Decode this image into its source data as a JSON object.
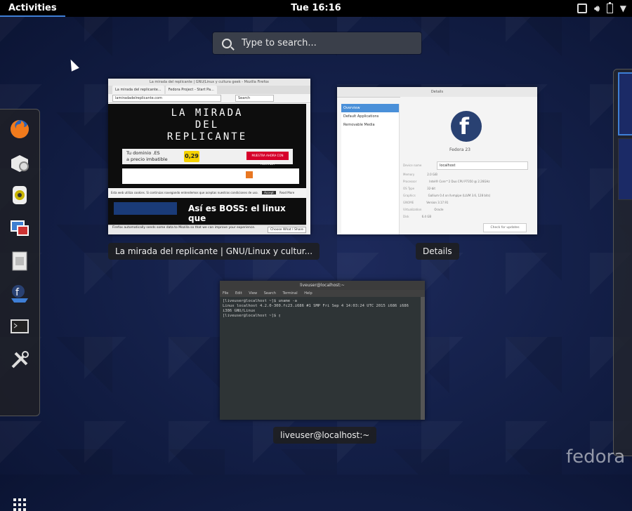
{
  "topbar": {
    "activities": "Activities",
    "clock": "Tue 16:16",
    "tray_icons": [
      "window-icon",
      "volume-icon",
      "battery-icon",
      "menu-arrow-icon"
    ]
  },
  "search": {
    "placeholder": "Type to search..."
  },
  "dash": {
    "apps": [
      "firefox-icon",
      "software-icon",
      "rhythmbox-icon",
      "photos-icon",
      "files-icon",
      "install-icon",
      "terminal-icon",
      "settings-icon"
    ],
    "show_apps": "app-grid-icon"
  },
  "windows": {
    "firefox": {
      "caption": "La mirada del replicante | GNU/Linux y cultur...",
      "title": "La mirada del replicante | GNU/Linux y cultura geek - Mozilla Firefox",
      "tab1": "La mirada del replicante...",
      "tab2": "Fedora Project - Start Pa...",
      "url": "lamiradadelreplicante.com",
      "search": "Search",
      "hero": [
        "LA MIRADA",
        "DEL",
        "REPLICANTE"
      ],
      "ad_line1": "Tu dominio .ES",
      "ad_line2": "a precio imbatible",
      "ad_price": "0,29",
      "ad_cta": "MUESTRA AHORA CON HOSTALIA",
      "headline": "Así es BOSS: el linux que",
      "cookie": "Esta web utiliza cookies. Si continúas navegando entendemos que aceptas nuestras condiciones de uso.",
      "cookie_accept": "Accept",
      "cookie_more": "Read More",
      "notify": "Firefox automatically sends some data to Mozilla so that we can improve your experience.",
      "notify_btn": "Choose What I Share"
    },
    "details": {
      "caption": "Details",
      "title": "Details",
      "sidebar": [
        "Overview",
        "Default Applications",
        "Removable Media"
      ],
      "os": "Fedora 23",
      "device_name_label": "Device name",
      "device_name": "localhost",
      "rows": [
        {
          "label": "Memory",
          "value": "2.0 GiB"
        },
        {
          "label": "Processor",
          "value": "Intel® Core™2 Duo CPU P7350 @ 2.26GHz"
        },
        {
          "label": "OS Type",
          "value": "32-bit"
        },
        {
          "label": "Graphics",
          "value": "Gallium 0.4 on llvmpipe (LLVM 3.6, 128 bits)"
        },
        {
          "label": "GNOME",
          "value": "Version 3.17.91"
        },
        {
          "label": "Virtualization",
          "value": "Oracle"
        },
        {
          "label": "Disk",
          "value": "6.4 GB"
        }
      ],
      "updates": "Check for updates"
    },
    "terminal": {
      "caption": "liveuser@localhost:~",
      "title": "liveuser@localhost:~",
      "menu": [
        "File",
        "Edit",
        "View",
        "Search",
        "Terminal",
        "Help"
      ],
      "lines": [
        "[liveuser@localhost ~]$ uname -a",
        "Linux localhost 4.2.0-300.fc23.i686 #1 SMP Fri Sep 4 14:03:24 UTC 2015 i686 i686",
        " i386 GNU/Linux",
        "[liveuser@localhost ~]$ ▯"
      ]
    }
  },
  "watermark": "fedora"
}
